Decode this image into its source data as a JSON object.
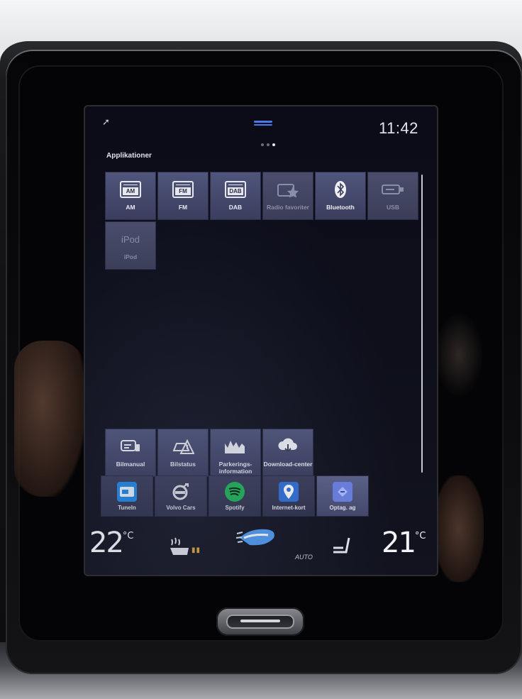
{
  "status_bar": {
    "time": "11:42"
  },
  "section": {
    "title": "Applikationer"
  },
  "app_tiles": [
    {
      "label": "AM",
      "icon": "am-radio-icon",
      "band": "AM",
      "enabled": true
    },
    {
      "label": "FM",
      "icon": "fm-radio-icon",
      "band": "FM",
      "enabled": true
    },
    {
      "label": "DAB",
      "icon": "dab-radio-icon",
      "band": "DAB",
      "enabled": true
    },
    {
      "label": "Radio favoriter",
      "icon": "radio-favorite-star-icon",
      "enabled": false
    },
    {
      "label": "Bluetooth",
      "icon": "bluetooth-icon",
      "enabled": true
    },
    {
      "label": "USB",
      "icon": "usb-icon",
      "enabled": false
    },
    {
      "label": "iPod",
      "icon": "ipod-icon",
      "title": "iPod",
      "enabled": false
    }
  ],
  "car_tiles": [
    {
      "label": "Bilmanual",
      "icon": "car-manual-icon"
    },
    {
      "label": "Bilstatus",
      "icon": "car-status-icon"
    },
    {
      "label": "Parkerings-information",
      "icon": "parking-info-icon"
    },
    {
      "label": "Download-center",
      "icon": "cloud-download-icon"
    }
  ],
  "dock": [
    {
      "label": "Tuneln",
      "icon": "tunein-icon",
      "color": "#1e88e5"
    },
    {
      "label": "Volvo Cars",
      "icon": "volvo-logo-icon",
      "color": "#3a3d5a"
    },
    {
      "label": "Spotify",
      "icon": "spotify-icon",
      "color": "#1db954"
    },
    {
      "label": "Internet-kort",
      "icon": "map-pin-icon",
      "color": "#2f6fd6"
    },
    {
      "label": "Optag. ag",
      "icon": "sync-icon",
      "color": "#5a6fd0"
    }
  ],
  "climate": {
    "left_temp": "22",
    "right_temp": "21",
    "unit": "°C",
    "auto_label": "AUTO"
  }
}
